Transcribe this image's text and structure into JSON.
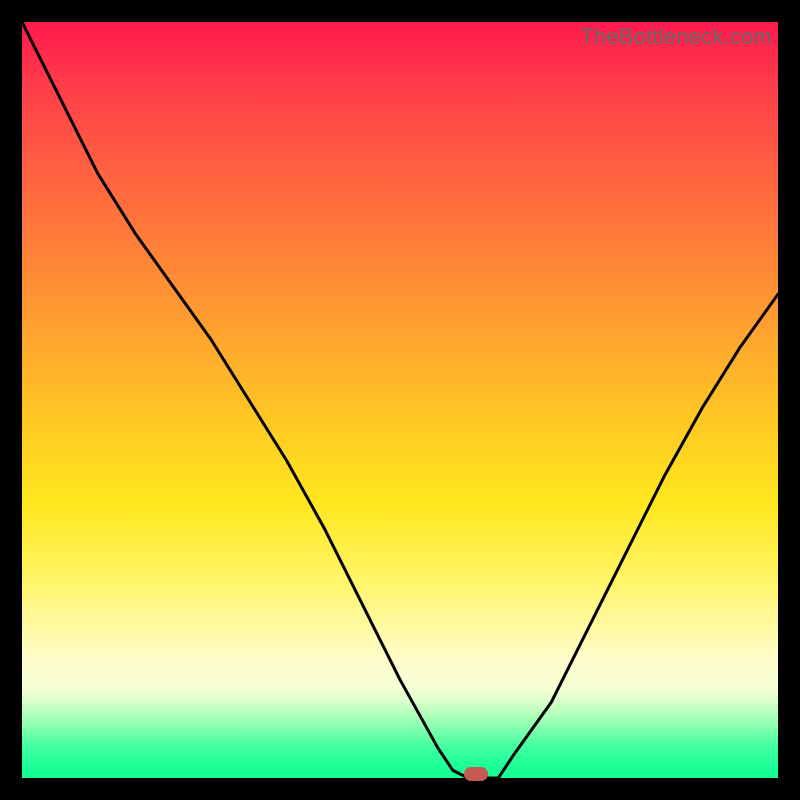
{
  "attribution": "TheBottleneck.com",
  "colors": {
    "frame": "#000000",
    "gradient_top": "#ff1a4d",
    "gradient_mid": "#ffe81f",
    "gradient_bottom": "#16ff93",
    "curve": "#000000",
    "marker": "#c4594f"
  },
  "chart_data": {
    "type": "line",
    "title": "",
    "xlabel": "",
    "ylabel": "",
    "xlim": [
      0,
      100
    ],
    "ylim": [
      0,
      100
    ],
    "x": [
      0,
      5,
      10,
      15,
      20,
      25,
      30,
      35,
      40,
      45,
      50,
      55,
      57,
      59,
      61,
      63,
      65,
      70,
      75,
      80,
      85,
      90,
      95,
      100
    ],
    "values": [
      100,
      90,
      80,
      72,
      65,
      58,
      50,
      42,
      33,
      23,
      13,
      4,
      1,
      0,
      0,
      0,
      3,
      10,
      20,
      30,
      40,
      49,
      57,
      64
    ],
    "marker": {
      "x": 60,
      "y": 0
    },
    "annotations": [
      {
        "text": "TheBottleneck.com",
        "pos": "top-right"
      }
    ]
  }
}
